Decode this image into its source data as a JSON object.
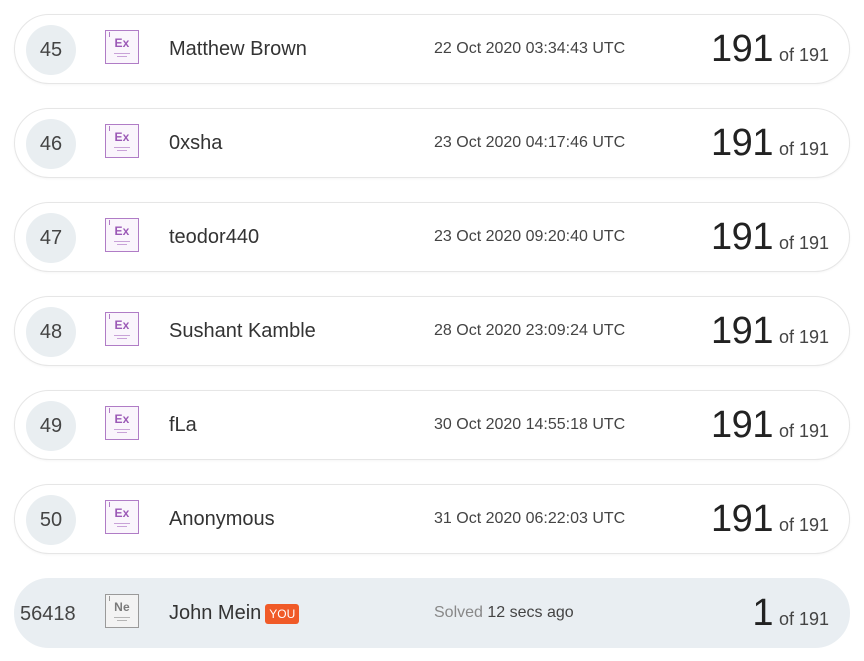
{
  "leaderboard": {
    "rows": [
      {
        "rank": "45",
        "badge": "Ex",
        "name": "Matthew Brown",
        "date": "22 Oct 2020 03:34:43 UTC",
        "score": "191",
        "of": "of 191"
      },
      {
        "rank": "46",
        "badge": "Ex",
        "name": "0xsha",
        "date": "23 Oct 2020 04:17:46 UTC",
        "score": "191",
        "of": "of 191"
      },
      {
        "rank": "47",
        "badge": "Ex",
        "name": "teodor440",
        "date": "23 Oct 2020 09:20:40 UTC",
        "score": "191",
        "of": "of 191"
      },
      {
        "rank": "48",
        "badge": "Ex",
        "name": "Sushant Kamble",
        "date": "28 Oct 2020 23:09:24 UTC",
        "score": "191",
        "of": "of 191"
      },
      {
        "rank": "49",
        "badge": "Ex",
        "name": "fLa",
        "date": "30 Oct 2020 14:55:18 UTC",
        "score": "191",
        "of": "of 191"
      },
      {
        "rank": "50",
        "badge": "Ex",
        "name": "Anonymous",
        "date": "31 Oct 2020 06:22:03 UTC",
        "score": "191",
        "of": "of 191"
      }
    ],
    "current_user": {
      "rank": "56418",
      "badge": "Ne",
      "name": "John Mein",
      "you_label": "YOU",
      "solved_label": "Solved",
      "solved_time": "12 secs ago",
      "score": "1",
      "of": "of 191"
    }
  },
  "colors": {
    "expert_badge": "#9b59b6",
    "newbie_badge": "#7a7a7a",
    "you_tag": "#f05a28",
    "rank_circle": "#e9eef1",
    "current_row_bg": "#e9eef2"
  }
}
